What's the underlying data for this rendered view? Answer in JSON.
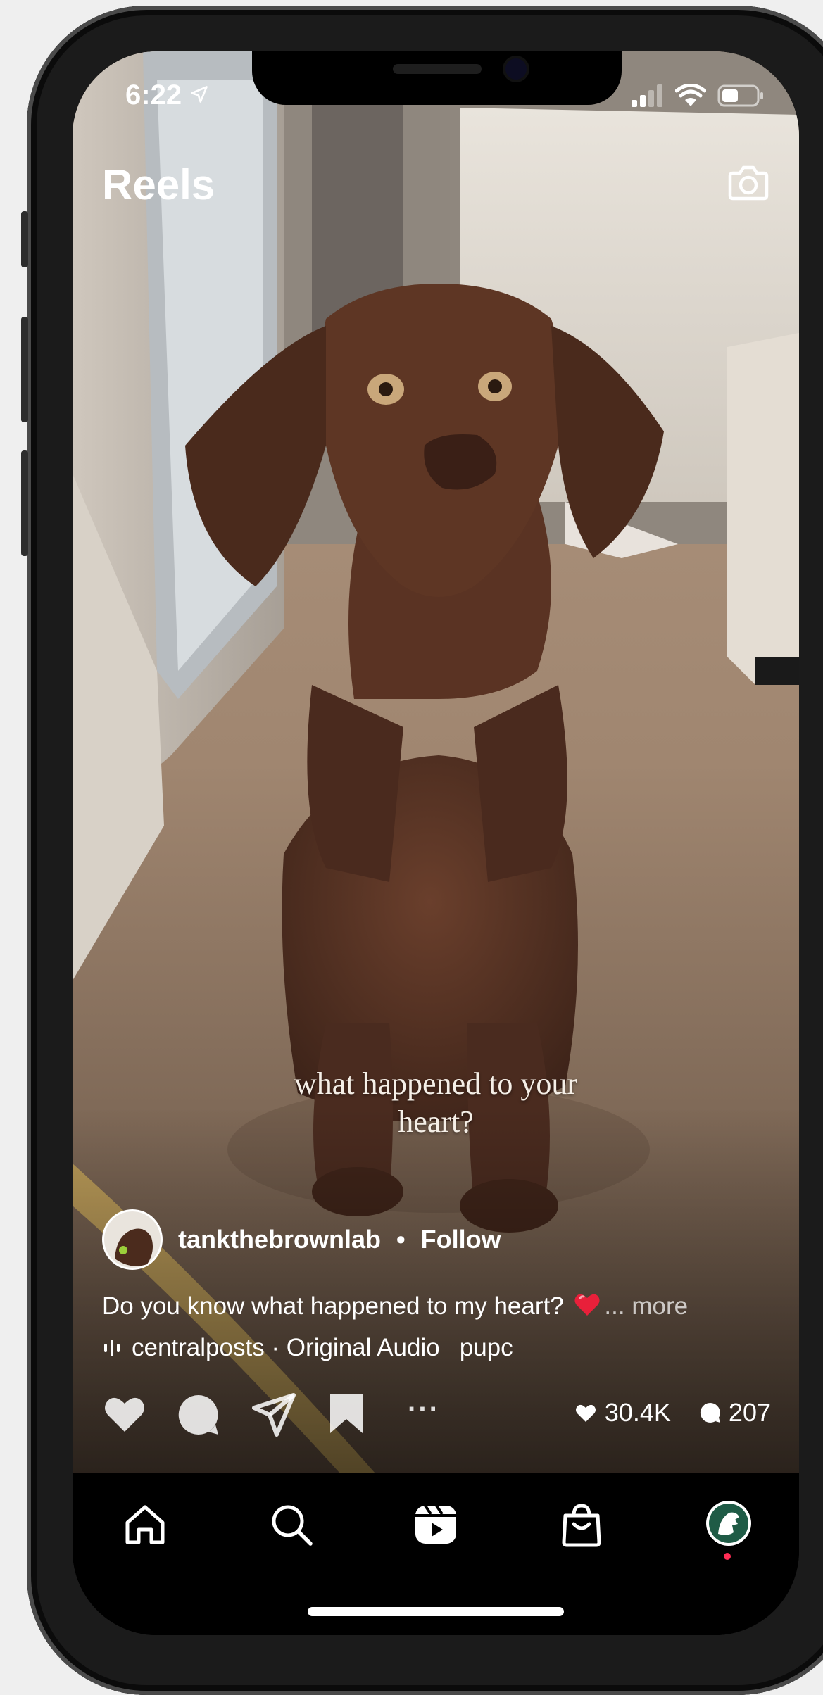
{
  "status_bar": {
    "time": "6:22"
  },
  "header": {
    "title": "Reels"
  },
  "video": {
    "overlay_text_line1": "what happened to your",
    "overlay_text_line2": "heart?"
  },
  "post": {
    "username": "tankthebrownlab",
    "separator": "•",
    "follow_label": "Follow",
    "caption_text": "Do you know what happened to my heart?",
    "caption_more": "... more",
    "audio_text": "centralposts · Original Audio",
    "audio_extra": "pupc"
  },
  "actions": {
    "more_label": "···",
    "likes": "30.4K",
    "comments": "207"
  },
  "tabs": [
    "home-icon",
    "search-icon",
    "reels-icon",
    "shop-icon",
    "profile-avatar"
  ],
  "colors": {
    "accent_red": "#ff2d55",
    "heart_red": "#e8203a"
  }
}
